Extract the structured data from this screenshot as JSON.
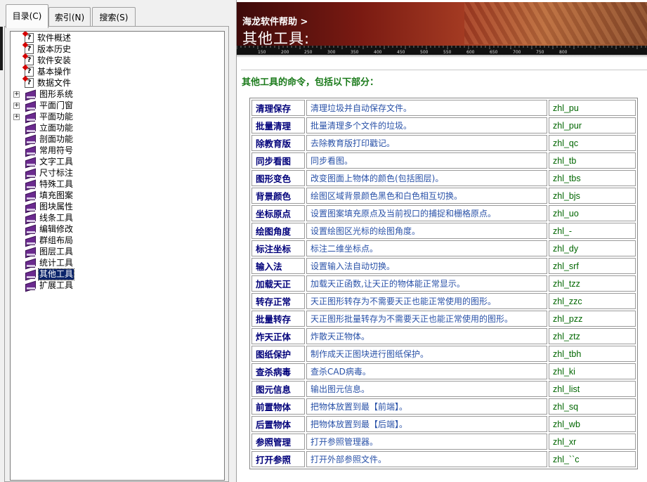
{
  "nav_tabs": [
    {
      "label": "目录(C)"
    },
    {
      "label": "索引(N)"
    },
    {
      "label": "搜索(S)"
    }
  ],
  "tree": {
    "items": [
      {
        "label": "软件概述",
        "icon": "help-page-icon"
      },
      {
        "label": "版本历史",
        "icon": "help-page-icon"
      },
      {
        "label": "软件安装",
        "icon": "help-page-icon"
      },
      {
        "label": "基本操作",
        "icon": "help-page-icon"
      },
      {
        "label": "数据文件",
        "icon": "help-page-icon"
      },
      {
        "label": "图形系统",
        "icon": "book-icon",
        "expander": "+"
      },
      {
        "label": "平面门窗",
        "icon": "book-icon",
        "expander": "+"
      },
      {
        "label": "平面功能",
        "icon": "book-icon",
        "expander": "+"
      },
      {
        "label": "立面功能",
        "icon": "book-icon"
      },
      {
        "label": "剖面功能",
        "icon": "book-icon"
      },
      {
        "label": "常用符号",
        "icon": "book-icon"
      },
      {
        "label": "文字工具",
        "icon": "book-icon"
      },
      {
        "label": "尺寸标注",
        "icon": "book-icon"
      },
      {
        "label": "特殊工具",
        "icon": "book-icon"
      },
      {
        "label": "填充图案",
        "icon": "book-icon"
      },
      {
        "label": "图块属性",
        "icon": "book-icon"
      },
      {
        "label": "线条工具",
        "icon": "book-icon"
      },
      {
        "label": "编辑修改",
        "icon": "book-icon"
      },
      {
        "label": "群组布局",
        "icon": "book-icon"
      },
      {
        "label": "图层工具",
        "icon": "book-icon"
      },
      {
        "label": "统计工具",
        "icon": "book-icon"
      },
      {
        "label": "其他工具",
        "icon": "book-icon",
        "selected": true
      },
      {
        "label": "扩展工具",
        "icon": "book-icon"
      }
    ]
  },
  "banner": {
    "breadcrumb": "海龙软件帮助 >",
    "title": "其他工具:",
    "ruler_labels": [
      "150",
      "200",
      "250",
      "300",
      "350",
      "400",
      "450",
      "500",
      "550",
      "600",
      "650",
      "700",
      "750",
      "800"
    ]
  },
  "intro": "其他工具的命令，包括以下部分：",
  "commands": [
    {
      "name": "清理保存",
      "desc": "清理垃圾并自动保存文件。",
      "cmd": "zhl_pu"
    },
    {
      "name": "批量清理",
      "desc": "批量清理多个文件的垃圾。",
      "cmd": "zhl_pur"
    },
    {
      "name": "除教育版",
      "desc": "去除教育版打印戳记。",
      "cmd": "zhl_qc"
    },
    {
      "name": "同步看图",
      "desc": "同步看图。",
      "cmd": "zhl_tb"
    },
    {
      "name": "图形变色",
      "desc": "改变图面上物体的颜色(包括图层)。",
      "cmd": "zhl_tbs"
    },
    {
      "name": "背景颜色",
      "desc": "绘图区域背景颜色黑色和白色相互切换。",
      "cmd": "zhl_bjs"
    },
    {
      "name": "坐标原点",
      "desc": "设置图案填充原点及当前视口的捕捉和栅格原点。",
      "cmd": "zhl_uo"
    },
    {
      "name": "绘图角度",
      "desc": "设置绘图区光标的绘图角度。",
      "cmd": "zhl_-"
    },
    {
      "name": "标注坐标",
      "desc": "标注二维坐标点。",
      "cmd": "zhl_dy"
    },
    {
      "name": "输入法",
      "desc": "设置输入法自动切换。",
      "cmd": "zhl_srf"
    },
    {
      "name": "加载天正",
      "desc": "加载天正函数,让天正的物体能正常显示。",
      "cmd": "zhl_tzz"
    },
    {
      "name": "转存正常",
      "desc": "天正图形转存为不需要天正也能正常使用的图形。",
      "cmd": "zhl_zzc"
    },
    {
      "name": "批量转存",
      "desc": "天正图形批量转存为不需要天正也能正常使用的图形。",
      "cmd": "zhl_pzz"
    },
    {
      "name": "炸天正体",
      "desc": "炸散天正物体。",
      "cmd": "zhl_ztz"
    },
    {
      "name": "图纸保护",
      "desc": "制作成天正图块进行图纸保护。",
      "cmd": "zhl_tbh"
    },
    {
      "name": "查杀病毒",
      "desc": "查杀CAD病毒。",
      "cmd": "zhl_ki"
    },
    {
      "name": "图元信息",
      "desc": "输出图元信息。",
      "cmd": "zhl_list"
    },
    {
      "name": "前置物体",
      "desc": "把物体放置到最【前端】。",
      "cmd": "zhl_sq"
    },
    {
      "name": "后置物体",
      "desc": "把物体放置到最【后端】。",
      "cmd": "zhl_wb"
    },
    {
      "name": "参照管理",
      "desc": "打开参照管理器。",
      "cmd": "zhl_xr"
    },
    {
      "name": "打开参照",
      "desc": "打开外部参照文件。",
      "cmd": "zhl_``c"
    }
  ]
}
